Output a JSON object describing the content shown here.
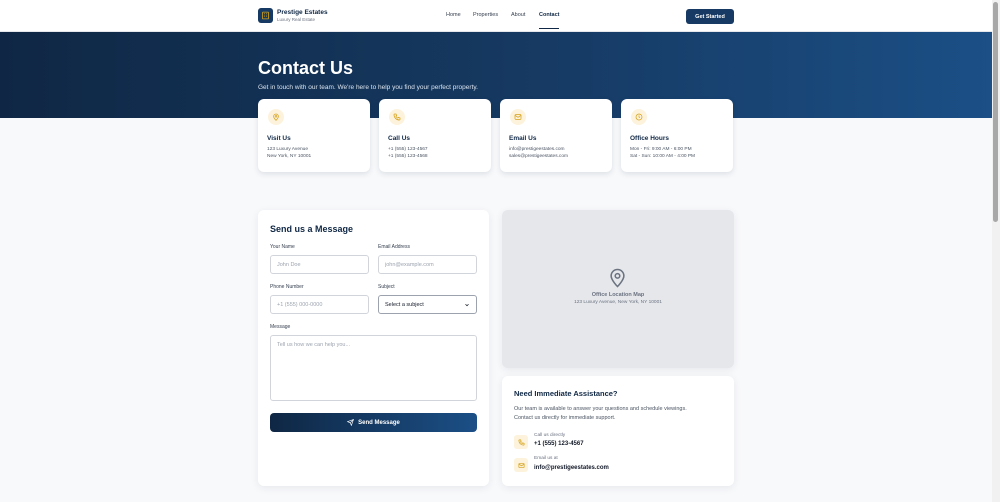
{
  "brand": {
    "name": "Prestige Estates",
    "tagline": "Luxury Real Estate"
  },
  "nav": {
    "links": [
      "Home",
      "Properties",
      "About",
      "Contact"
    ],
    "active": "Contact",
    "cta": "Get Started"
  },
  "hero": {
    "title": "Contact Us",
    "subtitle": "Get in touch with our team. We're here to help you find your perfect property."
  },
  "info_cards": [
    {
      "icon": "map-pin-icon",
      "title": "Visit Us",
      "lines": [
        "123 Luxury Avenue",
        "New York, NY 10001"
      ]
    },
    {
      "icon": "phone-icon",
      "title": "Call Us",
      "lines": [
        "+1 (555) 123-4567",
        "+1 (555) 123-4568"
      ]
    },
    {
      "icon": "mail-icon",
      "title": "Email Us",
      "lines": [
        "info@prestigeestates.com",
        "sales@prestigeestates.com"
      ]
    },
    {
      "icon": "clock-icon",
      "title": "Office Hours",
      "lines": [
        "Mon - Fri: 9:00 AM - 6:00 PM",
        "Sat - Sun: 10:00 AM - 4:00 PM"
      ]
    }
  ],
  "form": {
    "title": "Send us a Message",
    "name_label": "Your Name",
    "name_placeholder": "John Doe",
    "email_label": "Email Address",
    "email_placeholder": "john@example.com",
    "phone_label": "Phone Number",
    "phone_placeholder": "+1 (555) 000-0000",
    "subject_label": "Subject",
    "subject_value": "Select a subject",
    "message_label": "Message",
    "message_placeholder": "Tell us how we can help you...",
    "submit_label": "Send Message"
  },
  "map": {
    "title": "Office Location Map",
    "address": "123 Luxury Avenue, New York, NY 10001"
  },
  "assistance": {
    "title": "Need Immediate Assistance?",
    "desc_line1": "Our team is available to answer your questions and schedule viewings.",
    "desc_line2": "Contact us directly for immediate support.",
    "phone_label": "Call us directly",
    "phone_value": "+1 (555) 123-4567",
    "email_label": "Email us at",
    "email_value": "info@prestigeestates.com"
  },
  "colors": {
    "primary": "#0f2744",
    "accent": "#d4a017",
    "accent_bg": "#fdf3dc"
  }
}
